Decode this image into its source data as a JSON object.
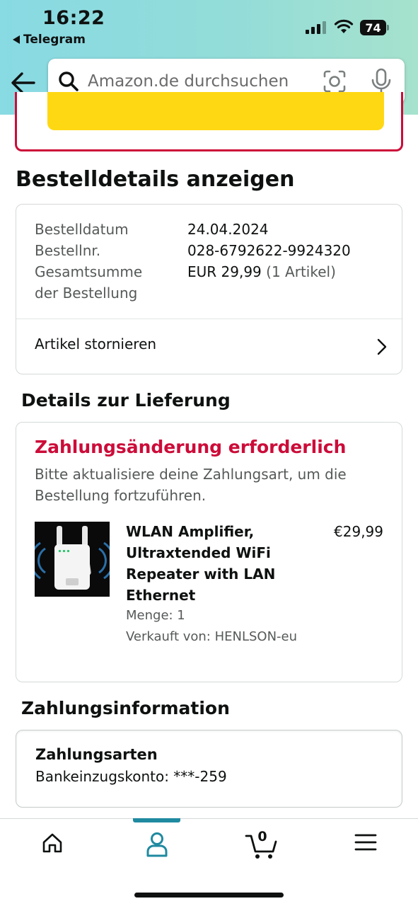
{
  "status_bar": {
    "time": "16:22",
    "back_app": "Telegram",
    "battery": "74"
  },
  "search": {
    "placeholder": "Amazon.de durchsuchen"
  },
  "order": {
    "heading": "Bestelldetails anzeigen",
    "rows": [
      {
        "label": "Bestelldatum",
        "value": "24.04.2024"
      },
      {
        "label": "Bestellnr.",
        "value": "028-6792622-9924320"
      },
      {
        "label_line1": "Gesamtsumme",
        "label_line2": "der Bestellung",
        "value": "EUR 29,99",
        "value_extra": "(1 Artikel)"
      }
    ],
    "cancel_label": "Artikel stornieren"
  },
  "delivery": {
    "heading": "Details zur Lieferung",
    "warning_title": "Zahlungsänderung erforderlich",
    "warning_text": "Bitte aktualisiere deine Zahlungsart, um die Bestellung fortzuführen.",
    "product": {
      "title": "WLAN Amplifier, Ultraxtended WiFi Repeater with LAN Ethernet",
      "price": "€29,99",
      "quantity": "Menge: 1",
      "seller": "Verkauft von: HENLSON-eu"
    }
  },
  "payment": {
    "heading": "Zahlungsinformation",
    "methods_title": "Zahlungsarten",
    "method_value": "Bankeinzugskonto: ***-259"
  },
  "bottom_nav": {
    "cart_count": "0",
    "active_tab": "account",
    "icons": [
      "home-icon",
      "account-icon",
      "cart-icon",
      "menu-icon"
    ]
  },
  "colors": {
    "accent_teal": "#1f8aa0",
    "alert_red": "#cc0c39",
    "button_yellow": "#ffd814",
    "header_gradient_start": "#88dae3",
    "header_gradient_end": "#a6e2cd"
  }
}
